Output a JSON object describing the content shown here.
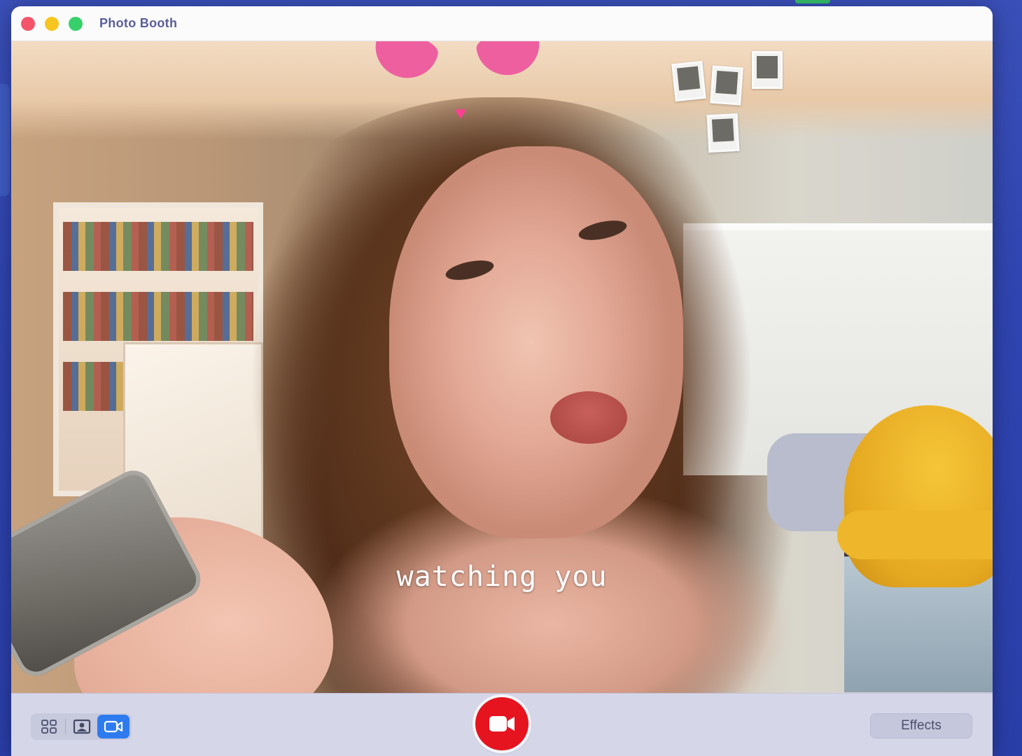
{
  "window": {
    "title": "Photo Booth"
  },
  "viewport": {
    "caption": "watching you"
  },
  "toolbar": {
    "modes": [
      {
        "name": "four-up-mode",
        "icon": "grid-icon",
        "active": false
      },
      {
        "name": "single-photo-mode",
        "icon": "portrait-icon",
        "active": false
      },
      {
        "name": "video-mode",
        "icon": "video-camera-icon",
        "active": true
      }
    ],
    "record_icon": "video-camera-icon",
    "effects_label": "Effects"
  },
  "colors": {
    "record": "#e5141f",
    "active_mode": "#2e7bf0",
    "traffic_red": "#f4546b",
    "traffic_yellow": "#f7c51f",
    "traffic_green": "#38d06a"
  }
}
